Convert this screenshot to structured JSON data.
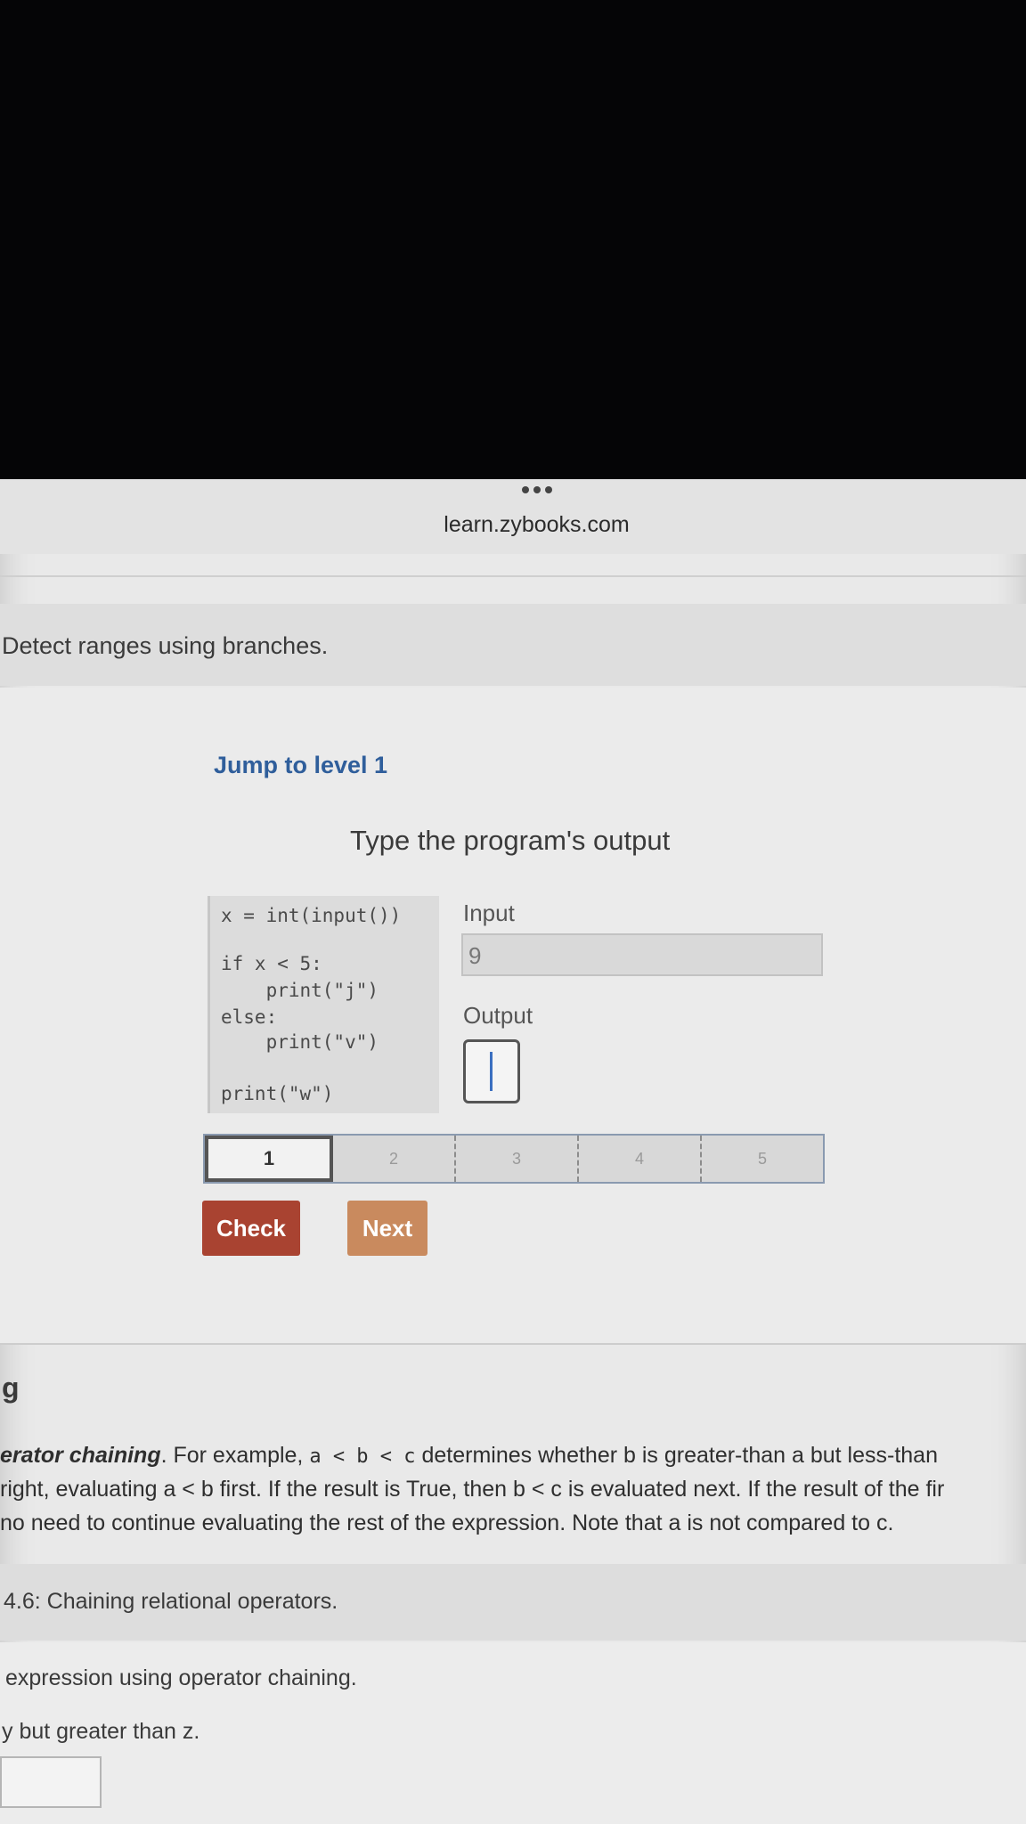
{
  "browser": {
    "url": "learn.zybooks.com"
  },
  "section": {
    "title": "Detect ranges using branches."
  },
  "activity": {
    "jump_label": "Jump to level 1",
    "prompt": "Type the program's output",
    "code_lines": [
      "x = int(input())",
      "if x < 5:",
      "    print(\"j\")",
      "else:",
      "    print(\"v\")",
      "print(\"w\")"
    ],
    "input_label": "Input",
    "input_value": "9",
    "output_label": "Output",
    "output_value": "",
    "levels": [
      "1",
      "2",
      "3",
      "4",
      "5"
    ],
    "current_level": 1,
    "check_label": "Check",
    "next_label": "Next"
  },
  "reading": {
    "heading": "g",
    "line1_term": "erator chaining",
    "line1_rest_a": ". For example, ",
    "line1_code": "a < b < c",
    "line1_rest_b": " determines whether b is greater-than a but less-than",
    "line2": "right, evaluating a < b first. If the result is True, then b < c is evaluated next. If the result of the fir",
    "line3": "no need to continue evaluating the rest of the expression. Note that a is not compared to c."
  },
  "participation": {
    "title": "4.6: Chaining relational operators.",
    "instruction": "expression using operator chaining.",
    "subtext": "y but greater than z."
  }
}
